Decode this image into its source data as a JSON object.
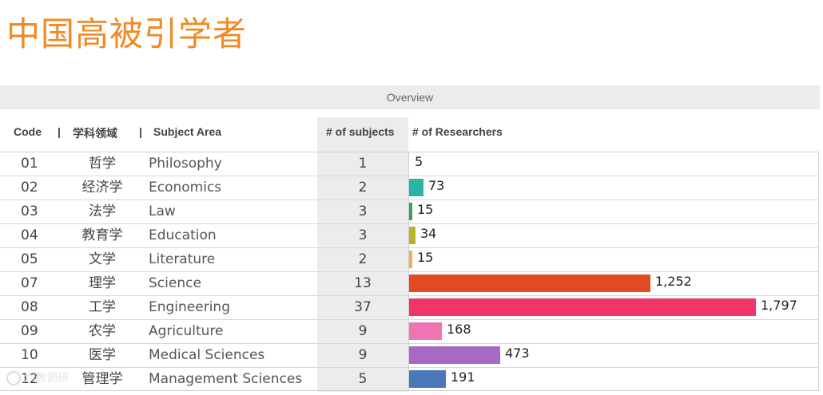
{
  "title": "中国高被引学者",
  "overview_label": "Overview",
  "headers": {
    "code": "Code",
    "sep1": "|",
    "cn": "学科领域",
    "sep2": "|",
    "en": "Subject Area",
    "subjects": "# of subjects",
    "researchers": "# of Researchers"
  },
  "watermark": "六数调研",
  "chart_data": {
    "type": "bar",
    "orientation": "horizontal",
    "title": "中国高被引学者",
    "columns": [
      "Code",
      "学科领域",
      "Subject Area",
      "# of subjects",
      "# of Researchers"
    ],
    "rows": [
      {
        "code": "01",
        "cn": "哲学",
        "en": "Philosophy",
        "subjects": "1",
        "researchers": 5,
        "label": "5",
        "color": "#ffffff"
      },
      {
        "code": "02",
        "cn": "经济学",
        "en": "Economics",
        "subjects": "2",
        "researchers": 73,
        "label": "73",
        "color": "#2bb5a0"
      },
      {
        "code": "03",
        "cn": "法学",
        "en": "Law",
        "subjects": "3",
        "researchers": 15,
        "label": "15",
        "color": "#3aa05f"
      },
      {
        "code": "04",
        "cn": "教育学",
        "en": "Education",
        "subjects": "3",
        "researchers": 34,
        "label": "34",
        "color": "#b8b42a"
      },
      {
        "code": "05",
        "cn": "文学",
        "en": "Literature",
        "subjects": "2",
        "researchers": 15,
        "label": "15",
        "color": "#f0b050"
      },
      {
        "code": "07",
        "cn": "理学",
        "en": "Science",
        "subjects": "13",
        "researchers": 1252,
        "label": "1,252",
        "color": "#e14a22"
      },
      {
        "code": "08",
        "cn": "工学",
        "en": "Engineering",
        "subjects": "37",
        "researchers": 1797,
        "label": "1,797",
        "color": "#f0356a"
      },
      {
        "code": "09",
        "cn": "农学",
        "en": "Agriculture",
        "subjects": "9",
        "researchers": 168,
        "label": "168",
        "color": "#ef74b4"
      },
      {
        "code": "10",
        "cn": "医学",
        "en": "Medical Sciences",
        "subjects": "9",
        "researchers": 473,
        "label": "473",
        "color": "#a66ac4"
      },
      {
        "code": "12",
        "cn": "管理学",
        "en": "Management Sciences",
        "subjects": "5",
        "researchers": 191,
        "label": "191",
        "color": "#4a78b8"
      }
    ],
    "xlim": [
      0,
      1797
    ]
  }
}
